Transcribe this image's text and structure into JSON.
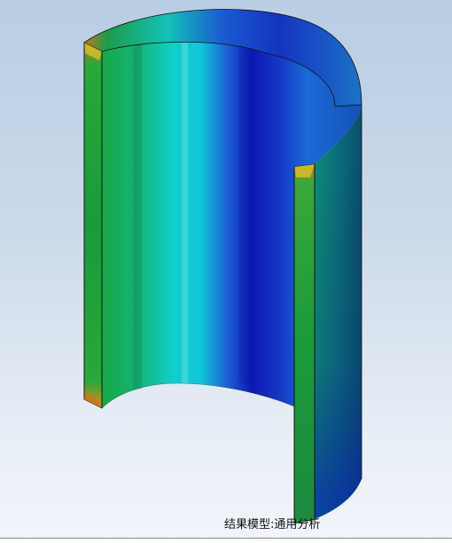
{
  "viewport": {
    "caption": "结果模型:通用分析"
  },
  "model": {
    "shape": "cut half-cylinder shell",
    "colors": {
      "deep_blue": "#0a14b4",
      "blue": "#1f3fd0",
      "cyan": "#10d4d4",
      "green": "#14a84a",
      "yellow": "#d7c22a",
      "orange": "#c8781e",
      "dark_teal": "#0a5a5a"
    }
  }
}
